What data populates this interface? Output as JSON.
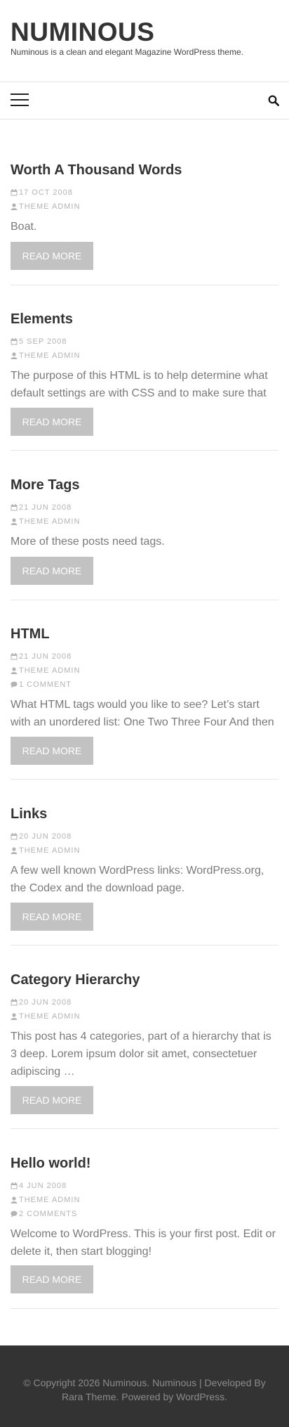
{
  "site": {
    "title": "NUMINOUS",
    "description": "Numinous is a clean and elegant Magazine WordPress theme."
  },
  "nav": {
    "menu_icon": "hamburger-menu-icon",
    "search_icon": "search-icon"
  },
  "read_more_label": "READ MORE",
  "meta_icons": {
    "date": "calendar-icon",
    "author": "user-icon",
    "comments": "comment-icon"
  },
  "posts": [
    {
      "title": "Worth A Thousand Words",
      "date": "17 OCT 2008",
      "author": "THEME ADMIN",
      "comments": "",
      "excerpt": "Boat."
    },
    {
      "title": "Elements",
      "date": "5 SEP 2008",
      "author": "THEME ADMIN",
      "comments": "",
      "excerpt": "The purpose of this HTML is to help determine what default settings are with CSS and to make sure that …"
    },
    {
      "title": "More Tags",
      "date": "21 JUN 2008",
      "author": "THEME ADMIN",
      "comments": "",
      "excerpt": "More of these posts need tags."
    },
    {
      "title": "HTML",
      "date": "21 JUN 2008",
      "author": "THEME ADMIN",
      "comments": "1 COMMENT",
      "excerpt": "What HTML tags would you like to see? Let’s start with an unordered list: One Two Three Four And then …"
    },
    {
      "title": "Links",
      "date": "20 JUN 2008",
      "author": "THEME ADMIN",
      "comments": "",
      "excerpt": "A few well known WordPress links: WordPress.org, the Codex and the download page."
    },
    {
      "title": "Category Hierarchy",
      "date": "20 JUN 2008",
      "author": "THEME ADMIN",
      "comments": "",
      "excerpt": "This post has 4 categories, part of a hierarchy that is 3 deep. Lorem ipsum dolor sit amet, consectetuer adipiscing …"
    },
    {
      "title": "Hello world!",
      "date": "4 JUN 2008",
      "author": "THEME ADMIN",
      "comments": "2 COMMENTS",
      "excerpt": "Welcome to WordPress. This is your first post. Edit or delete it, then start blogging!"
    }
  ],
  "footer": {
    "copyright": "© Copyright 2026 ",
    "site_link": "Numinous",
    "separator": ". ",
    "theme_name": "Numinous",
    "developed_by": " | Developed By ",
    "developer_link": "Rara Theme",
    "powered_by": ". Powered by ",
    "wordpress_link": "WordPress",
    "end": "."
  }
}
